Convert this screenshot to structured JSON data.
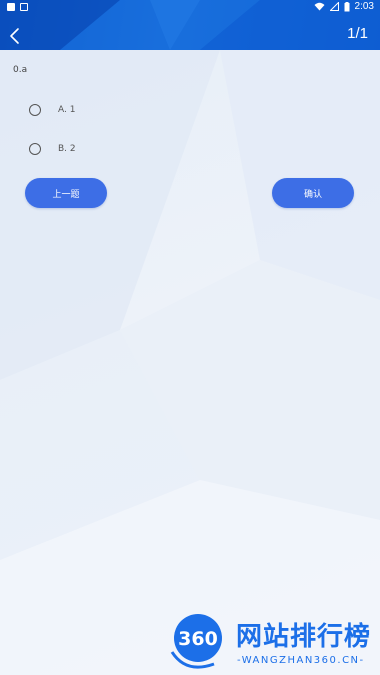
{
  "status_bar": {
    "time": "2:03",
    "left_icons": [
      "gallery-icon",
      "app-a-icon"
    ],
    "right_icons": [
      "wifi-icon",
      "signal-icon",
      "battery-icon"
    ]
  },
  "header": {
    "back_icon": "chevron-left-icon",
    "page_counter": "1/1"
  },
  "question": {
    "title": "0.a",
    "options": [
      {
        "label": "A. 1",
        "selected": false
      },
      {
        "label": "B. 2",
        "selected": false
      }
    ]
  },
  "actions": {
    "prev_label": "上一题",
    "confirm_label": "确认"
  },
  "watermark": {
    "number": "360",
    "cn_text": "网站排行榜",
    "en_text": "-WANGZHAN360.CN-"
  },
  "colors": {
    "header": "#1769d9",
    "button": "#3d6ee6",
    "watermark": "#1c6fe8"
  }
}
